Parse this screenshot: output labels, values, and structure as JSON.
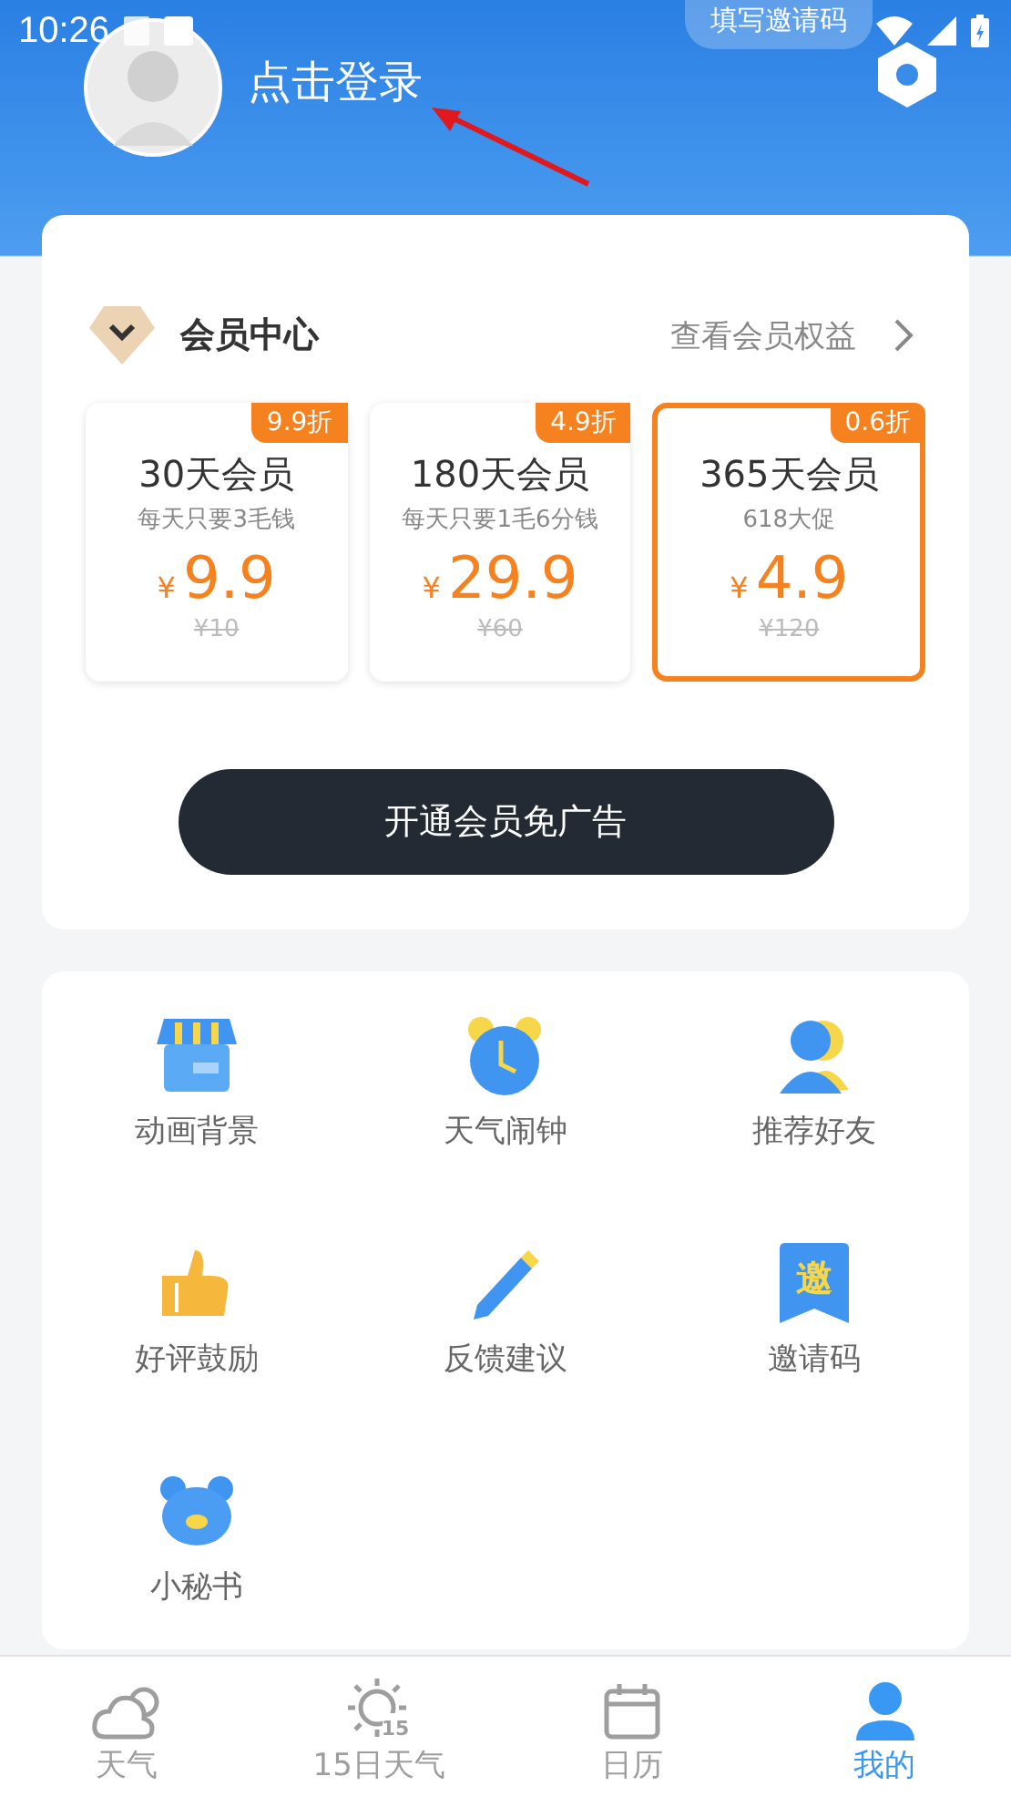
{
  "status_bar": {
    "time": "10:26"
  },
  "invite_bubble": {
    "label": "填写邀请码"
  },
  "profile": {
    "login_label": "点击登录"
  },
  "membership": {
    "title": "会员中心",
    "link": "查看会员权益",
    "plans": [
      {
        "discount": "9.9折",
        "name": "30天会员",
        "subtitle": "每天只要3毛钱",
        "currency": "¥",
        "price": "9.9",
        "original_price": "¥10",
        "selected": false
      },
      {
        "discount": "4.9折",
        "name": "180天会员",
        "subtitle": "每天只要1毛6分钱",
        "currency": "¥",
        "price": "29.9",
        "original_price": "¥60",
        "selected": false
      },
      {
        "discount": "0.6折",
        "name": "365天会员",
        "subtitle": "618大促",
        "currency": "¥",
        "price": "4.9",
        "original_price": "¥120",
        "selected": true
      }
    ],
    "button": "开通会员免广告"
  },
  "features": [
    {
      "kind": "store",
      "label": "动画背景"
    },
    {
      "kind": "alarm",
      "label": "天气闹钟"
    },
    {
      "kind": "person",
      "label": "推荐好友"
    },
    {
      "kind": "thumb",
      "label": "好评鼓励"
    },
    {
      "kind": "pencil",
      "label": "反馈建议"
    },
    {
      "kind": "invite",
      "label": "邀请码",
      "icon_text": "邀"
    },
    {
      "kind": "bear",
      "label": "小秘书"
    }
  ],
  "tabs": [
    {
      "kind": "cloud",
      "label": "天气",
      "selected": false
    },
    {
      "kind": "sun",
      "label": "15日天气",
      "icon_text": "15",
      "selected": false
    },
    {
      "kind": "calendar",
      "label": "日历",
      "selected": false
    },
    {
      "kind": "user",
      "label": "我的",
      "selected": true
    }
  ]
}
